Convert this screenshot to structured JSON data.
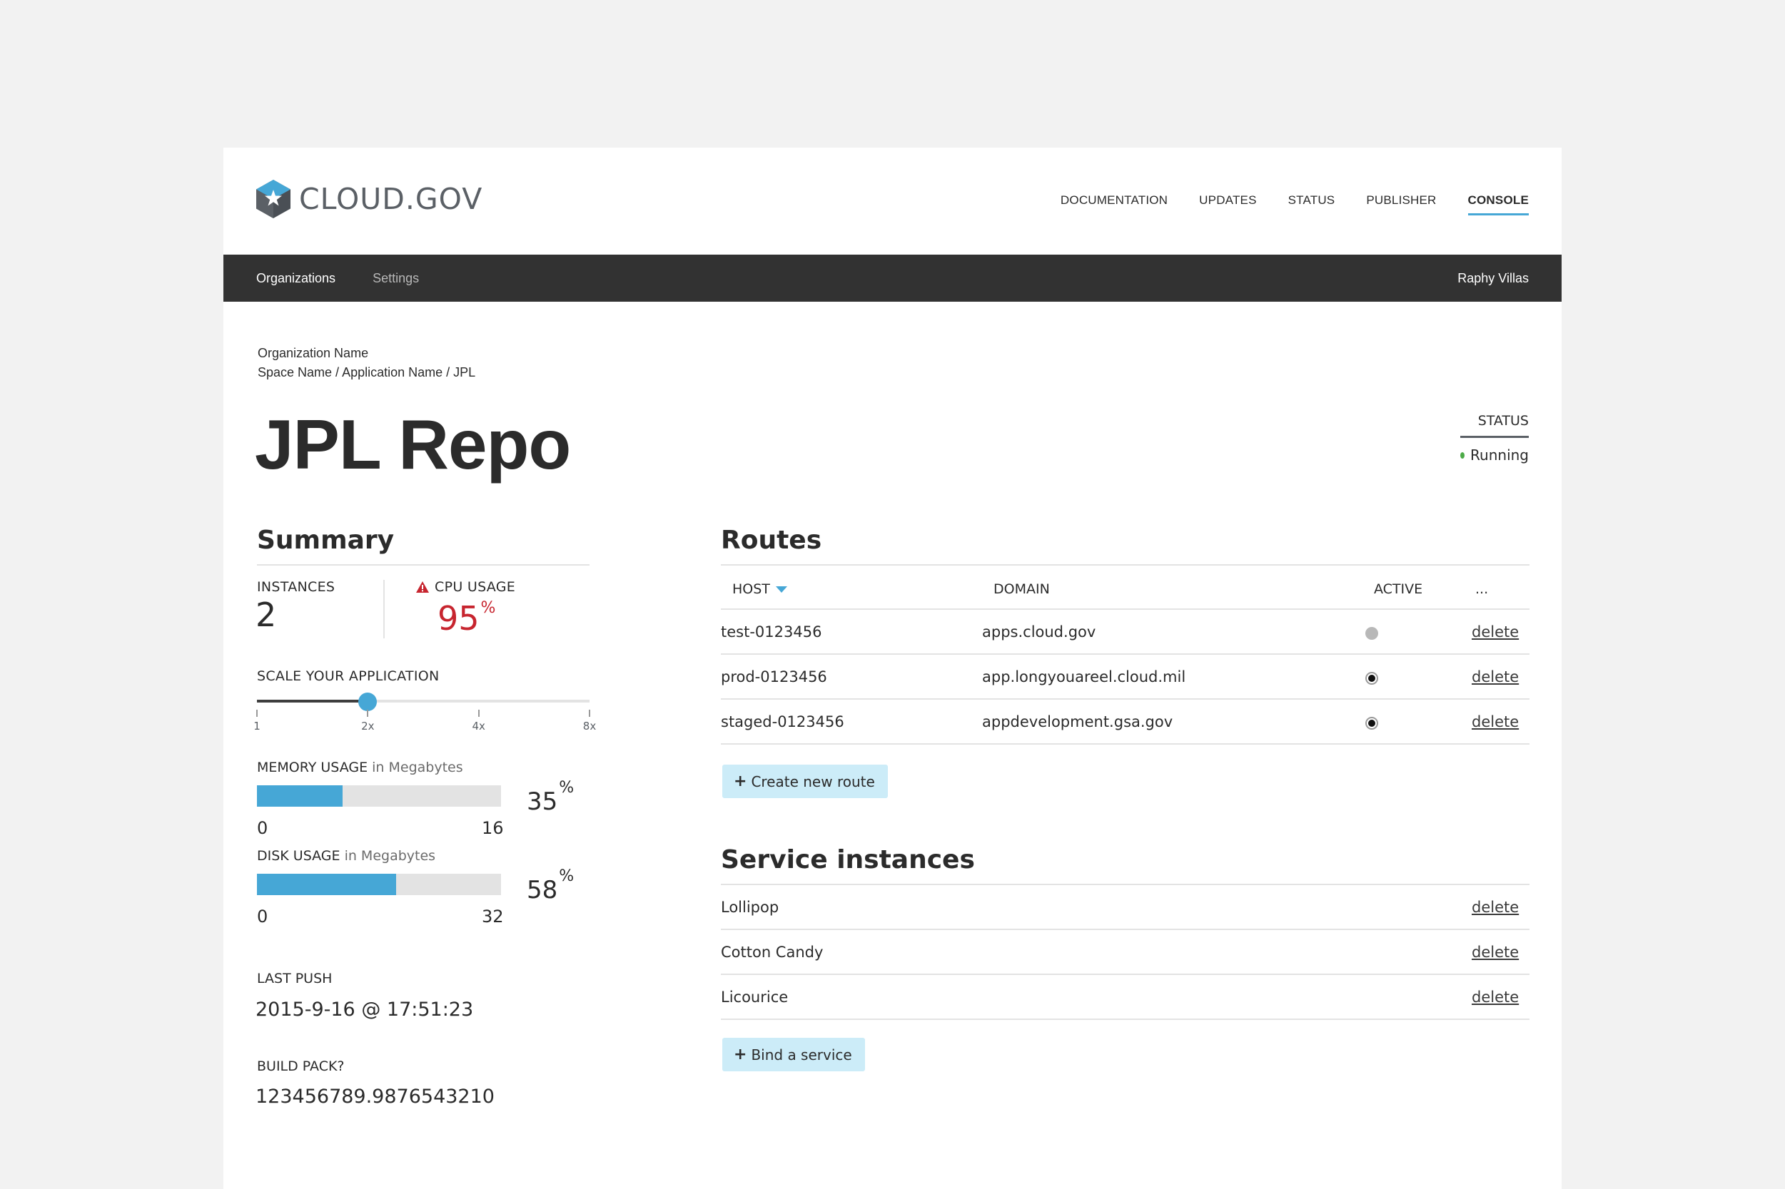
{
  "header": {
    "logo_text": "CLOUD.GOV",
    "nav": [
      "DOCUMENTATION",
      "UPDATES",
      "STATUS",
      "PUBLISHER",
      "CONSOLE"
    ],
    "active_nav": "CONSOLE",
    "accent_color": "#46a7d6"
  },
  "subnav": {
    "organizations": "Organizations",
    "settings": "Settings",
    "user": "Raphy Villas"
  },
  "breadcrumb": {
    "line1": "Organization Name",
    "line2": "Space Name / Application Name / JPL"
  },
  "page_title": "JPL Repo",
  "status": {
    "label": "STATUS",
    "value": "Running",
    "color": "#4cab47"
  },
  "summary": {
    "title": "Summary",
    "instances_label": "INSTANCES",
    "instances_value": "2",
    "cpu_label": "CPU USAGE",
    "cpu_value": "95",
    "cpu_unit": "%",
    "cpu_color": "#c7252f",
    "scale_label": "SCALE YOUR APPLICATION",
    "scale_ticks": [
      "1",
      "2x",
      "4x",
      "8x"
    ],
    "scale_selected_index": 1,
    "memory": {
      "label": "MEMORY USAGE",
      "unit_label": "in Megabytes",
      "min": "0",
      "max": "16",
      "percent": "35",
      "percent_unit": "%",
      "fraction": 0.35
    },
    "disk": {
      "label": "DISK USAGE",
      "unit_label": "in Megabytes",
      "min": "0",
      "max": "32",
      "percent": "58",
      "percent_unit": "%",
      "fraction": 0.57
    },
    "last_push_label": "LAST PUSH",
    "last_push_value": "2015-9-16 @ 17:51:23",
    "build_pack_label": "BUILD PACK?",
    "build_pack_value": "123456789.9876543210"
  },
  "routes": {
    "title": "Routes",
    "columns": [
      "HOST",
      "DOMAIN",
      "ACTIVE",
      "..."
    ],
    "rows": [
      {
        "host": "test-0123456",
        "domain": "apps.cloud.gov",
        "active": false,
        "action": "delete"
      },
      {
        "host": "prod-0123456",
        "domain": "app.longyouareel.cloud.mil",
        "active": true,
        "action": "delete"
      },
      {
        "host": "staged-0123456",
        "domain": "appdevelopment.gsa.gov",
        "active": true,
        "action": "delete"
      }
    ],
    "create_button": "Create new route"
  },
  "services": {
    "title": "Service instances",
    "rows": [
      {
        "name": "Lollipop",
        "action": "delete"
      },
      {
        "name": "Cotton Candy",
        "action": "delete"
      },
      {
        "name": "Licourice",
        "action": "delete"
      }
    ],
    "bind_button": "Bind a service"
  }
}
